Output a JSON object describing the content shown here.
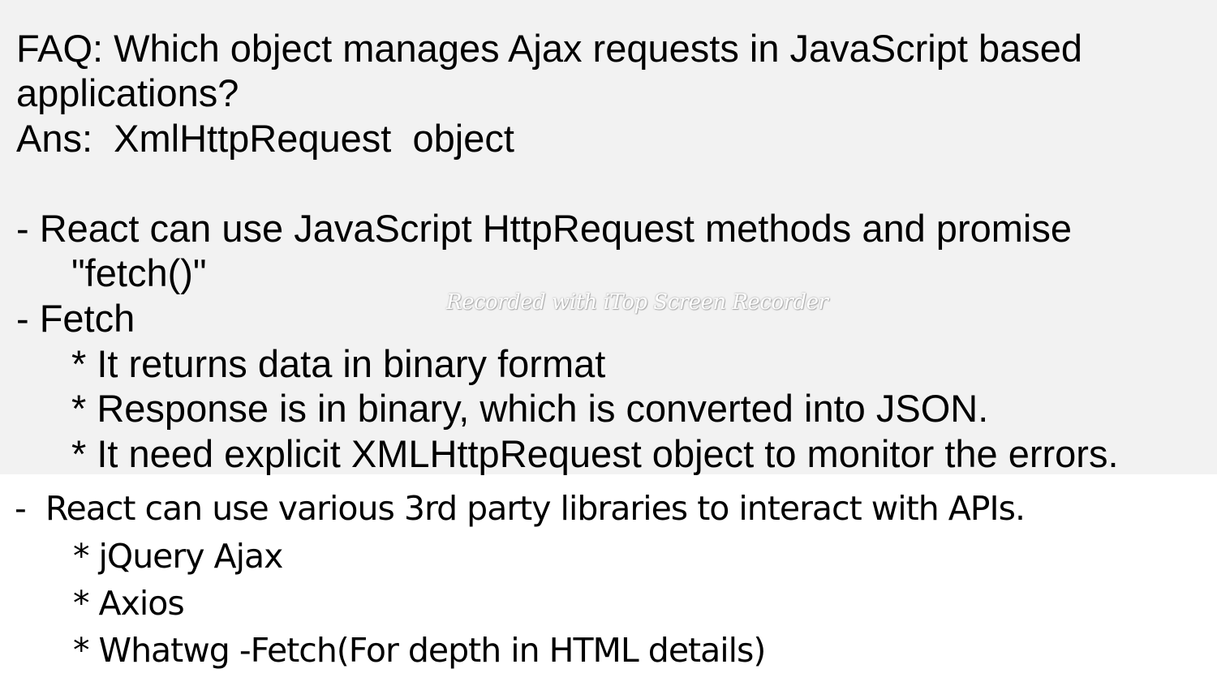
{
  "slide": {
    "faq": {
      "question_line1": "FAQ: Which object manages Ajax requests in JavaScript based",
      "question_line2": "applications?",
      "answer": "Ans:  XmlHttpRequest  object"
    },
    "react_http": {
      "line1": "- React can use JavaScript HttpRequest methods and promise",
      "line2": "\"fetch()\""
    },
    "fetch": {
      "heading": "- Fetch",
      "points": [
        "* It returns data in binary format",
        "* Response is in binary, which is converted into JSON.",
        "* It need explicit XMLHttpRequest object to monitor the errors."
      ]
    },
    "third_party": {
      "heading": "-  React can use various 3rd party libraries to interact with APIs.",
      "items": [
        "* jQuery Ajax",
        "* Axios",
        "* Whatwg -Fetch(For depth in HTML details)"
      ]
    }
  },
  "watermark": "Recorded with iTop Screen Recorder",
  "colors": {
    "top_background": "#f2f2f2",
    "bottom_background": "#ffffff",
    "text": "#000000"
  }
}
